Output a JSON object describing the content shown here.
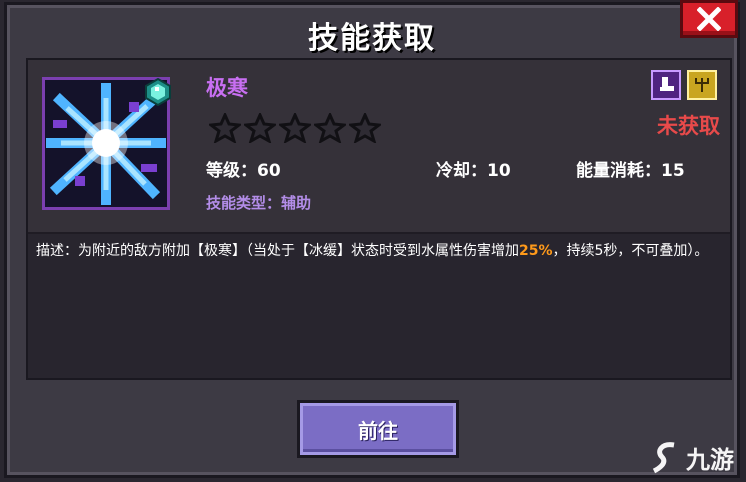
{
  "dialog": {
    "title": "技能获取",
    "go_button": "前往"
  },
  "skill": {
    "name": "极寒",
    "stars_filled": 0,
    "stars_total": 5,
    "status": "未获取",
    "level": "等级：60",
    "cooldown": "冷却：10",
    "energy_cost": "能量消耗：15",
    "type": "技能类型：辅助",
    "description_prefix": "描述：为附近的敌方附加【极寒】（当处于【冰缓】状态时受到水属性伤害增加",
    "description_highlight": "25%",
    "description_suffix": "，持续5秒，不可叠加）。"
  },
  "watermark": "九游",
  "colors": {
    "skill_name": "#c86ff2",
    "status": "#e84a4a",
    "highlight": "#ff9a1a",
    "button": "#7b6dc5",
    "close": "#d8202a"
  },
  "icons": [
    "close-icon",
    "skill-frost-icon",
    "gem-icon",
    "star-icon",
    "boot-badge-icon",
    "rune-badge-icon",
    "jiuyou-logo"
  ]
}
